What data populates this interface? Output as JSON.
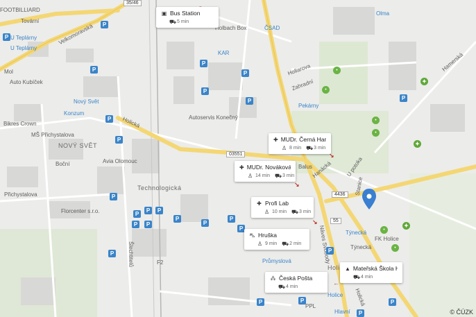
{
  "map": {
    "credit": "© ČÚZK",
    "place_labels": [
      "FOOTBILLIARD",
      "Tovární",
      "Velkomoravská",
      "U Teplárny",
      "U Teplárny",
      "Mol",
      "Auto Kubíček",
      "Nový Svět",
      "Konzum",
      "Bikres Crown",
      "MŠ Přichystalova",
      "NOVÝ SVĚT",
      "Boční",
      "Přichystalova",
      "Florcenter s.r.o.",
      "Holická",
      "Avia Olomouc",
      "Technologická",
      "Šlechtitelů",
      "F2",
      "Bus Station",
      "Holbach Box",
      "KAR",
      "ČSAD",
      "Autoservis Konečný",
      "Hollarova",
      "Zahradní",
      "Pekárny",
      "Olma",
      "Hamerská",
      "U potoka",
      "Hanácká",
      "Stanice",
      "Balus",
      "Týnecká",
      "Týnecká",
      "FK Holice",
      "Náves Svobody",
      "Průmyslová",
      "Holice",
      "Holice",
      "Hlavní",
      "PPL",
      "Holická"
    ],
    "road_numbers": [
      "35/46",
      "03551",
      "4436",
      "55"
    ]
  },
  "cards": [
    {
      "title": "Bus Station",
      "icon": "bus-icon",
      "metrics": [
        {
          "icon": "car-icon",
          "value": "5 min"
        }
      ]
    },
    {
      "title": "MUDr. Černá Hana",
      "icon": "medical-cross-icon",
      "metrics": [
        {
          "icon": "walk-icon",
          "value": "8 min"
        },
        {
          "icon": "car-icon",
          "value": "3 min"
        }
      ]
    },
    {
      "title": "MUDr. Nováková ...",
      "icon": "medical-cross-icon",
      "metrics": [
        {
          "icon": "walk-icon",
          "value": "14 min"
        },
        {
          "icon": "car-icon",
          "value": "3 min"
        }
      ]
    },
    {
      "title": "Profi Lab",
      "icon": "medical-cross-icon",
      "metrics": [
        {
          "icon": "walk-icon",
          "value": "10 min"
        },
        {
          "icon": "car-icon",
          "value": "3 min"
        }
      ]
    },
    {
      "title": "Hruška",
      "icon": "cart-icon",
      "metrics": [
        {
          "icon": "walk-icon",
          "value": "9 min"
        },
        {
          "icon": "car-icon",
          "value": "2 min"
        }
      ]
    },
    {
      "title": "Česká Pošta",
      "icon": "post-icon",
      "metrics": [
        {
          "icon": "car-icon",
          "value": "4 min"
        }
      ]
    },
    {
      "title": "Mateřská Škola H...",
      "icon": "school-icon",
      "metrics": [
        {
          "icon": "car-icon",
          "value": "4 min"
        }
      ]
    }
  ]
}
